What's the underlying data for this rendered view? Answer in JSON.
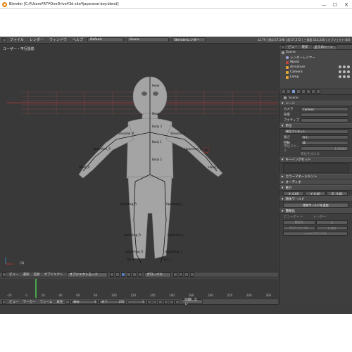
{
  "window": {
    "title": "Blender [C:¥Users¥R7¥OneDrive¥3d site¥japanese-boy.blend]",
    "min": "—",
    "max": "☐",
    "close": "✕"
  },
  "menu": {
    "items": [
      "ファイル",
      "レンダー",
      "ウィンドウ",
      "ヘルプ"
    ],
    "layout": "Default",
    "scene": "Scene",
    "engine": "Blenderレンダー",
    "info": "v2.79 | 頂点:57,598 | 面:57,372 | 三角面:114,240 | オブジェクト:0/4"
  },
  "viewport": {
    "header": "ユーザー・平行投影",
    "frame_label": "(1)",
    "bones": [
      "Body 1",
      "Body 2",
      "Body 3",
      "Neck",
      "Head",
      "Shoulder_L",
      "Shoulder_R",
      "UpperArm_L",
      "UpperArm_R",
      "Hand_L",
      "Hand_R",
      "UpperLeg_L",
      "UpperLeg_R",
      "LowerLeg_L",
      "LowerLeg_R",
      "UpperFoot_L",
      "UpperFoot_R",
      "Toe_L",
      "Toe_R"
    ]
  },
  "viewport_header": {
    "items": [
      "ビュー",
      "選択",
      "追加",
      "オブジェクト"
    ],
    "mode": "オブジェクトモード",
    "pivot": "グローバル"
  },
  "timeline": {
    "ticks": [
      "-20",
      "0",
      "20",
      "40",
      "60",
      "80",
      "100",
      "120",
      "140",
      "160",
      "180",
      "200",
      "220",
      "240",
      "260"
    ],
    "header_items": [
      "ビュー",
      "マーカー",
      "フレーム",
      "再生"
    ],
    "start_label": "開始:",
    "start": "1",
    "end_label": "終了:",
    "end": "250",
    "current": "1",
    "sync": "同期しない"
  },
  "outliner": {
    "tabs": [
      "ビュー",
      "検索",
      "全てのシーン"
    ],
    "rows": [
      {
        "label": "Scene",
        "indent": 0,
        "color": "#9a9a9a"
      },
      {
        "label": "レンダーレイヤー",
        "indent": 1,
        "color": "#9b9bd8"
      },
      {
        "label": "World",
        "indent": 1,
        "color": "#c5433c"
      },
      {
        "label": "Armature",
        "indent": 1,
        "color": "#e6a335"
      },
      {
        "label": "Camera",
        "indent": 1,
        "color": "#e6a335"
      },
      {
        "label": "Lamp",
        "indent": 1,
        "color": "#e6a335"
      }
    ]
  },
  "properties": {
    "breadcrumb": "Scene",
    "scene_section": "シーン",
    "camera_label": "カメラ",
    "camera_value": "Camera",
    "background_label": "背景",
    "active_label": "アクティブ",
    "units_section": "単位",
    "units_preset": "単位プリセット",
    "length_label": "長さ",
    "length_value": "なし",
    "rotation_label": "回転",
    "rotation_value": "度",
    "unit_scale_label": "単位スケール",
    "unit_scale_value": "1.00000",
    "separate_label": "単位を分ける",
    "keying_section": "キーイングセット",
    "color_mgmt_section": "カラーマネージメント",
    "audio_section": "オーディオ",
    "gravity_section": "重力",
    "gravity_x": "X: 0.00",
    "gravity_y": "Y: 0.00",
    "gravity_z": "Z: -9.81",
    "rigid_section": "剛体ワールド",
    "rigid_button": "剛体ワールドを追加",
    "simplify_section": "簡略化",
    "viewport_label": "ビューポート:",
    "render_label": "レンダー:",
    "subdiv_label": "細分化",
    "subdiv_value": "6",
    "child_label": "子パーティクル",
    "child_value": "1.000",
    "shadow_label": "シャドウサンプル"
  }
}
